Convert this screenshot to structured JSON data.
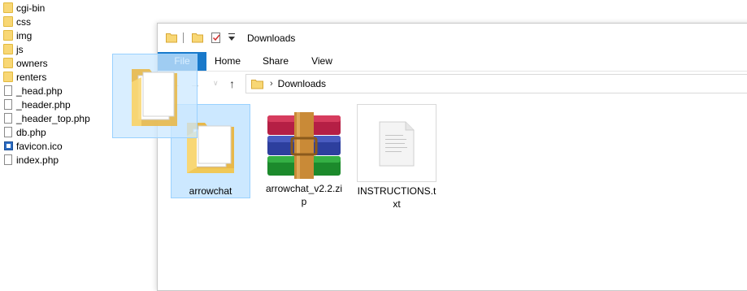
{
  "tree": {
    "items": [
      {
        "type": "folder",
        "label": "cgi-bin"
      },
      {
        "type": "folder",
        "label": "css"
      },
      {
        "type": "folder",
        "label": "img"
      },
      {
        "type": "folder",
        "label": "js"
      },
      {
        "type": "folder",
        "label": "owners"
      },
      {
        "type": "folder",
        "label": "renters"
      },
      {
        "type": "file",
        "label": "_head.php"
      },
      {
        "type": "file",
        "label": "_header.php"
      },
      {
        "type": "file",
        "label": "_header_top.php"
      },
      {
        "type": "file",
        "label": "db.php"
      },
      {
        "type": "favicon",
        "label": "favicon.ico"
      },
      {
        "type": "file",
        "label": "index.php"
      }
    ]
  },
  "window": {
    "title": "Downloads",
    "ribbon_tabs": [
      "File",
      "Home",
      "Share",
      "View"
    ],
    "address": {
      "path": "Downloads"
    },
    "files": [
      {
        "name_line1": "arrowchat",
        "name_line2": "",
        "kind": "folder",
        "selected": true
      },
      {
        "name_line1": "arrowchat_v2.2.zi",
        "name_line2": "p",
        "kind": "archive",
        "selected": false
      },
      {
        "name_line1": "INSTRUCTIONS.t",
        "name_line2": "xt",
        "kind": "text",
        "selected": false
      }
    ]
  },
  "colors": {
    "accent": "#1979ca",
    "selection_fill": "#cce8ff",
    "selection_border": "#99d1ff",
    "folder": "#f8d775"
  },
  "icons": [
    "folder-icon",
    "file-icon",
    "favicon-icon",
    "checkmark-icon",
    "dropdown-icon",
    "back-icon",
    "forward-icon",
    "recent-icon",
    "up-icon",
    "chevron-right-icon",
    "winrar-icon",
    "text-document-icon"
  ]
}
